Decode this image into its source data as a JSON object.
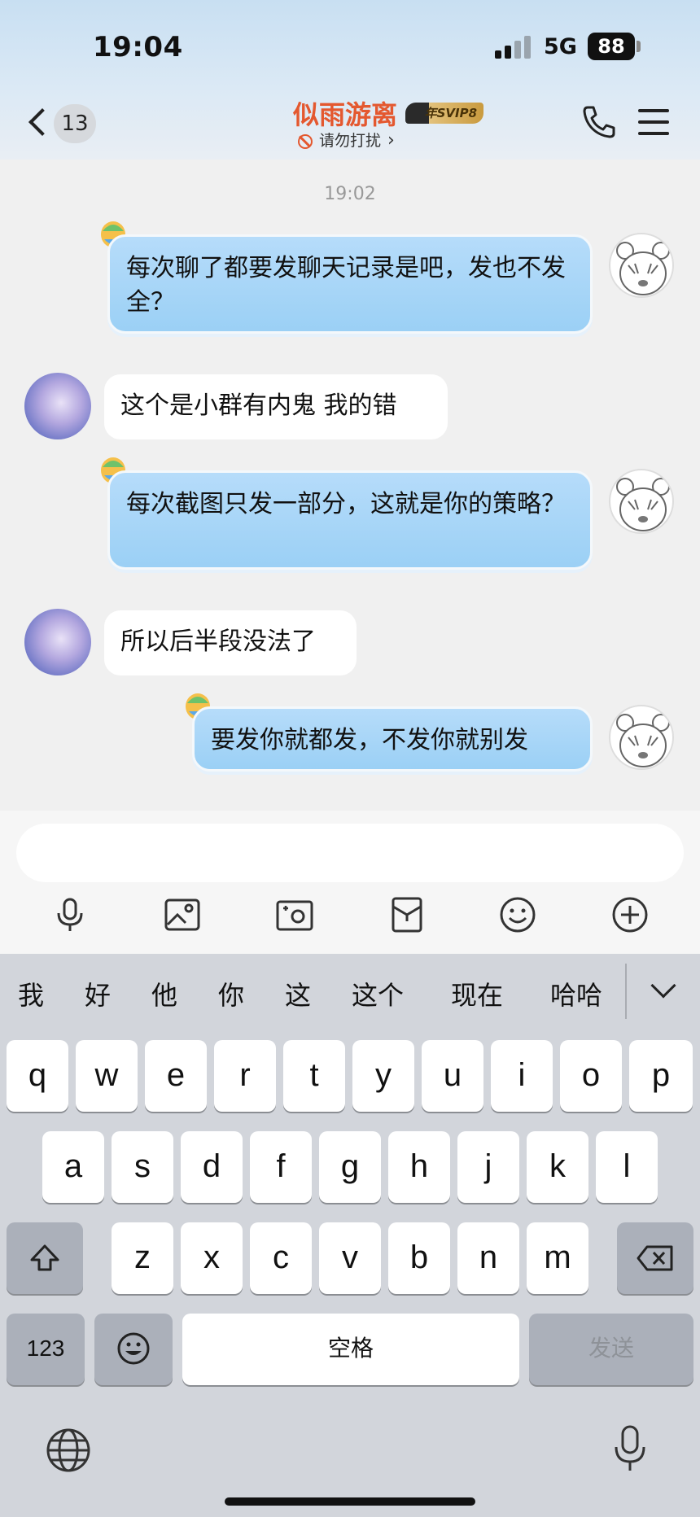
{
  "status_bar": {
    "time": "19:04",
    "network": "5G",
    "battery": "88"
  },
  "header": {
    "unread_count": "13",
    "title": "似雨游离",
    "vip_badge": "年SVIP8",
    "subtitle": "请勿打扰"
  },
  "chat": {
    "timestamp": "19:02",
    "messages": [
      {
        "side": "out",
        "text": "每次聊了都要发聊天记录是吧，发也不发全？"
      },
      {
        "side": "in",
        "text": "这个是小群有内鬼 我的错"
      },
      {
        "side": "out",
        "text": "每次截图只发一部分，这就是你的策略？"
      },
      {
        "side": "in",
        "text": "所以后半段没法了"
      },
      {
        "side": "out",
        "text": "要发你就都发，不发你就别发"
      }
    ]
  },
  "composer": {
    "input_value": "",
    "tools": [
      "microphone-icon",
      "image-icon",
      "camera-icon",
      "red-packet-icon",
      "emoji-icon",
      "plus-icon"
    ]
  },
  "keyboard": {
    "candidates": [
      "我",
      "好",
      "他",
      "你",
      "这",
      "这个",
      "现在",
      "哈哈"
    ],
    "row1": [
      "q",
      "w",
      "e",
      "r",
      "t",
      "y",
      "u",
      "i",
      "o",
      "p"
    ],
    "row2": [
      "a",
      "s",
      "d",
      "f",
      "g",
      "h",
      "j",
      "k",
      "l"
    ],
    "row3": [
      "z",
      "x",
      "c",
      "v",
      "b",
      "n",
      "m"
    ],
    "numbers_label": "123",
    "space_label": "空格",
    "send_label": "发送"
  },
  "colors": {
    "accent": "#e4582f",
    "out_bubble": "#9bd0f5",
    "keyboard_bg": "#d2d5db"
  }
}
